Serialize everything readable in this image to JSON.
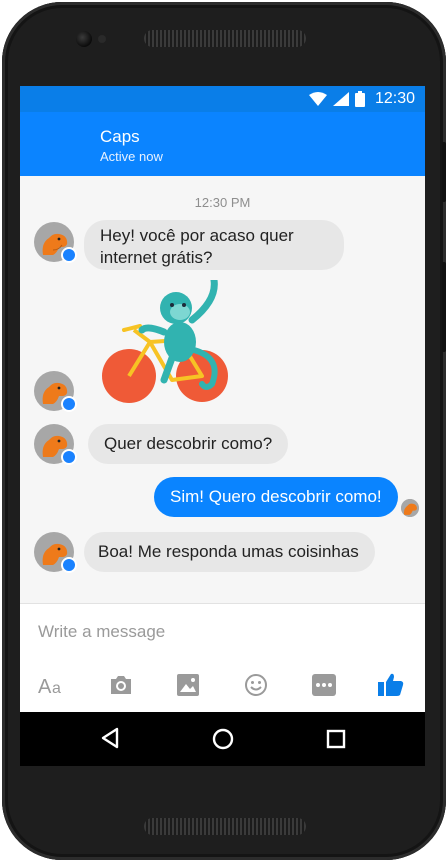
{
  "status_bar": {
    "time": "12:30"
  },
  "header": {
    "contact_name": "Caps",
    "status": "Active now"
  },
  "conversation": {
    "timestamp": "12:30 PM",
    "messages": [
      {
        "from": "them",
        "line1": "Hey! você por acaso quer",
        "line2": "internet grátis?"
      },
      {
        "from": "them",
        "sticker": "monkey-on-bicycle"
      },
      {
        "from": "them",
        "text": "Quer descobrir como?"
      },
      {
        "from": "me",
        "text": "Sim! Quero descobrir como!"
      },
      {
        "from": "them",
        "text": "Boa! Me responda umas coisinhas"
      }
    ]
  },
  "composer": {
    "placeholder": "Write a message",
    "tools": [
      "text-format-icon",
      "camera-icon",
      "gallery-icon",
      "emoji-icon",
      "more-icon",
      "like-icon"
    ]
  },
  "navigation": {
    "buttons": [
      "back-icon",
      "home-icon",
      "recents-icon"
    ]
  },
  "colors": {
    "brand_blue": "#0b84ff",
    "incoming_bubble": "#e7e7e7",
    "outgoing_bubble": "#0a84ff"
  }
}
